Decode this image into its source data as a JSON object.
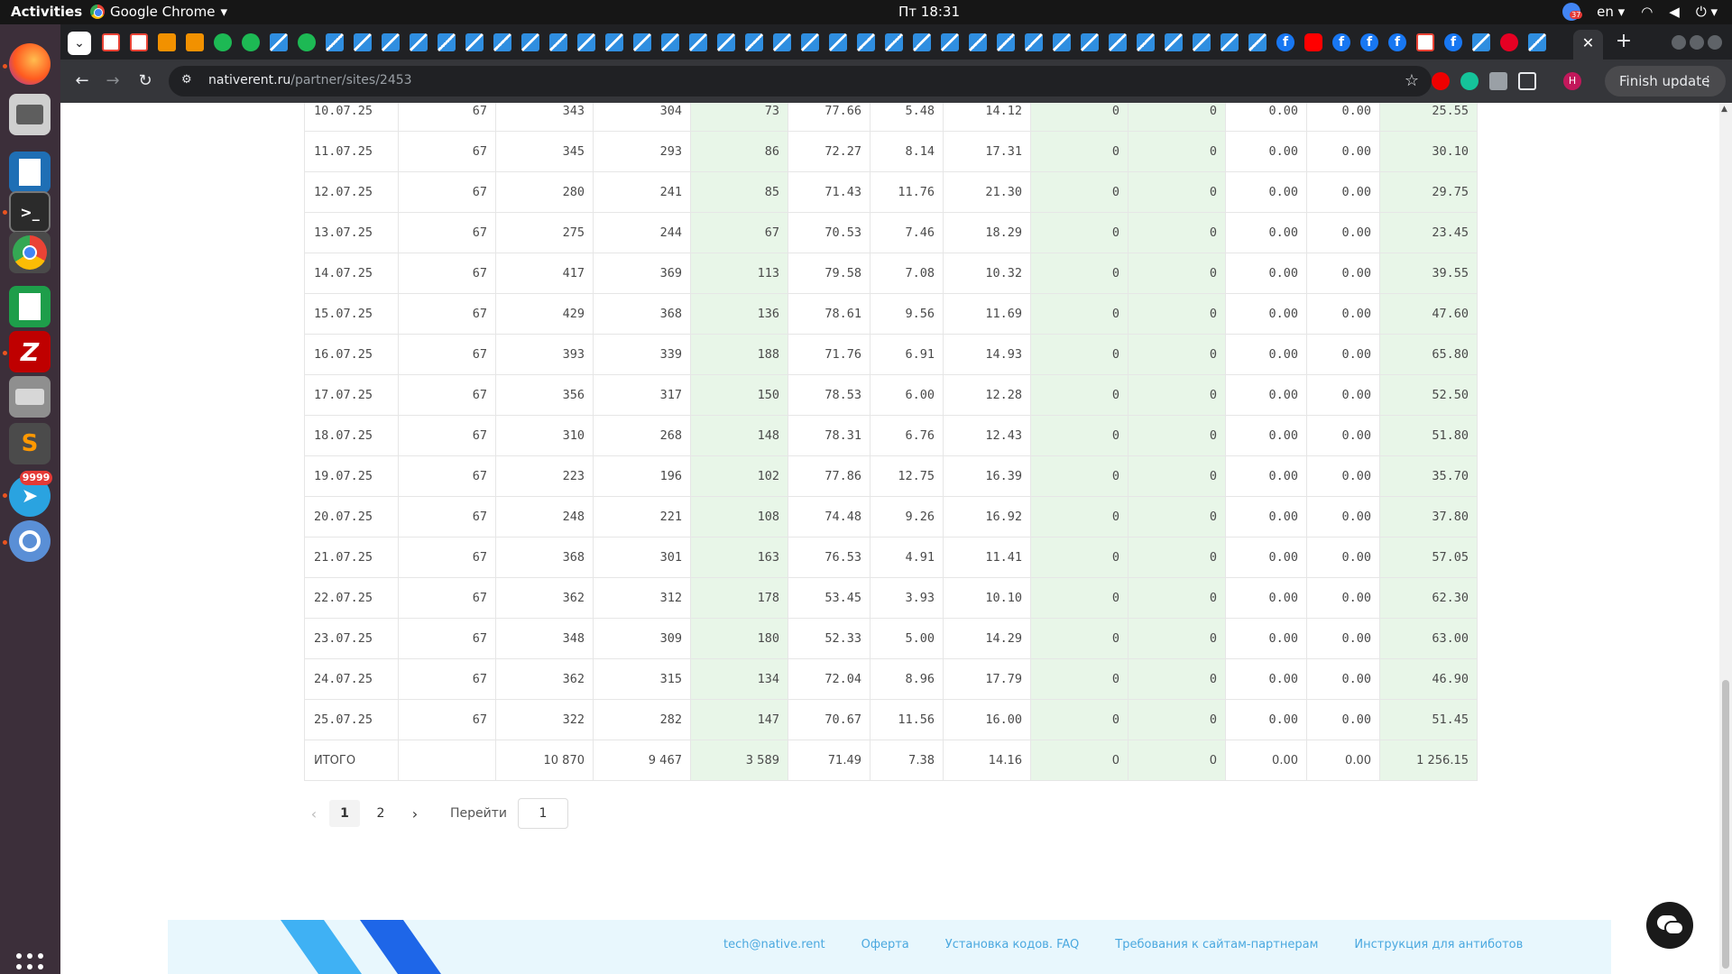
{
  "topbar": {
    "activities": "Activities",
    "app_name": "Google Chrome",
    "clock": "Пт 18:31",
    "lang": "en",
    "notif_count": "37"
  },
  "dock": {
    "telegram_badge": "9999"
  },
  "browser": {
    "url_host": "nativerent.ru",
    "url_path": "/partner/sites/2453",
    "finish_update": "Finish update",
    "profile_initial": "H"
  },
  "table": {
    "rows": [
      [
        "10.07.25",
        "67",
        "343",
        "304",
        "73",
        "77.66",
        "5.48",
        "14.12",
        "0",
        "0",
        "0.00",
        "0.00",
        "25.55"
      ],
      [
        "11.07.25",
        "67",
        "345",
        "293",
        "86",
        "72.27",
        "8.14",
        "17.31",
        "0",
        "0",
        "0.00",
        "0.00",
        "30.10"
      ],
      [
        "12.07.25",
        "67",
        "280",
        "241",
        "85",
        "71.43",
        "11.76",
        "21.30",
        "0",
        "0",
        "0.00",
        "0.00",
        "29.75"
      ],
      [
        "13.07.25",
        "67",
        "275",
        "244",
        "67",
        "70.53",
        "7.46",
        "18.29",
        "0",
        "0",
        "0.00",
        "0.00",
        "23.45"
      ],
      [
        "14.07.25",
        "67",
        "417",
        "369",
        "113",
        "79.58",
        "7.08",
        "10.32",
        "0",
        "0",
        "0.00",
        "0.00",
        "39.55"
      ],
      [
        "15.07.25",
        "67",
        "429",
        "368",
        "136",
        "78.61",
        "9.56",
        "11.69",
        "0",
        "0",
        "0.00",
        "0.00",
        "47.60"
      ],
      [
        "16.07.25",
        "67",
        "393",
        "339",
        "188",
        "71.76",
        "6.91",
        "14.93",
        "0",
        "0",
        "0.00",
        "0.00",
        "65.80"
      ],
      [
        "17.07.25",
        "67",
        "356",
        "317",
        "150",
        "78.53",
        "6.00",
        "12.28",
        "0",
        "0",
        "0.00",
        "0.00",
        "52.50"
      ],
      [
        "18.07.25",
        "67",
        "310",
        "268",
        "148",
        "78.31",
        "6.76",
        "12.43",
        "0",
        "0",
        "0.00",
        "0.00",
        "51.80"
      ],
      [
        "19.07.25",
        "67",
        "223",
        "196",
        "102",
        "77.86",
        "12.75",
        "16.39",
        "0",
        "0",
        "0.00",
        "0.00",
        "35.70"
      ],
      [
        "20.07.25",
        "67",
        "248",
        "221",
        "108",
        "74.48",
        "9.26",
        "16.92",
        "0",
        "0",
        "0.00",
        "0.00",
        "37.80"
      ],
      [
        "21.07.25",
        "67",
        "368",
        "301",
        "163",
        "76.53",
        "4.91",
        "11.41",
        "0",
        "0",
        "0.00",
        "0.00",
        "57.05"
      ],
      [
        "22.07.25",
        "67",
        "362",
        "312",
        "178",
        "53.45",
        "3.93",
        "10.10",
        "0",
        "0",
        "0.00",
        "0.00",
        "62.30"
      ],
      [
        "23.07.25",
        "67",
        "348",
        "309",
        "180",
        "52.33",
        "5.00",
        "14.29",
        "0",
        "0",
        "0.00",
        "0.00",
        "63.00"
      ],
      [
        "24.07.25",
        "67",
        "362",
        "315",
        "134",
        "72.04",
        "8.96",
        "17.79",
        "0",
        "0",
        "0.00",
        "0.00",
        "46.90"
      ],
      [
        "25.07.25",
        "67",
        "322",
        "282",
        "147",
        "70.67",
        "11.56",
        "16.00",
        "0",
        "0",
        "0.00",
        "0.00",
        "51.45"
      ]
    ],
    "total": [
      "ИТОГО",
      "",
      "10 870",
      "9 467",
      "3 589",
      "71.49",
      "7.38",
      "14.16",
      "0",
      "0",
      "0.00",
      "0.00",
      "1 256.15"
    ]
  },
  "pagination": {
    "prev": "‹",
    "pages": [
      "1",
      "2"
    ],
    "active": "1",
    "next": "›",
    "goto_label": "Перейти",
    "goto_value": "1"
  },
  "footer": {
    "links": [
      "tech@native.rent",
      "Оферта",
      "Установка кодов. FAQ",
      "Требования к сайтам-партнерам",
      "Инструкция для антиботов"
    ]
  },
  "colors": {
    "highlight_column": "#e8f6e8",
    "footer_bg": "#e8f7fd",
    "link": "#4aa8df"
  }
}
